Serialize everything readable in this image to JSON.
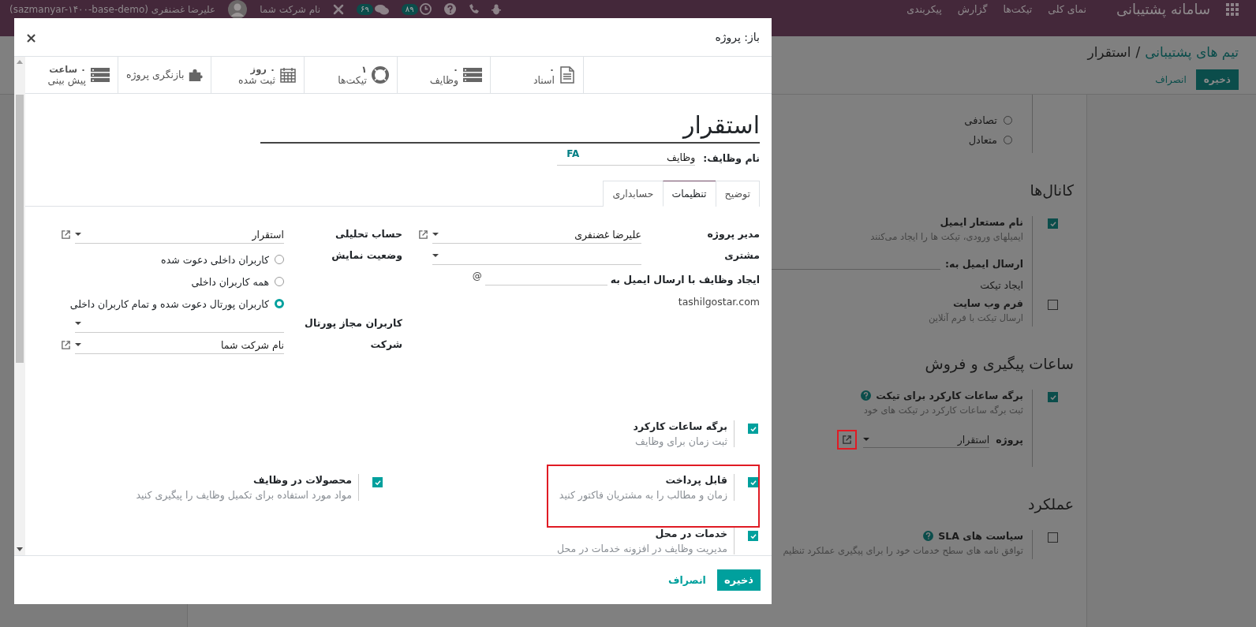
{
  "navbar": {
    "brand": "سامانه پشتیبانی",
    "menu": [
      "نمای کلی",
      "تیکت‌ها",
      "گزارش",
      "پیکربندی"
    ],
    "activity_count": "۸۹",
    "message_count": "۶۹",
    "company": "نام شرکت شما",
    "user": "علیرضا غضنفری (sazmanyar-۱۴۰۰-base-demo)"
  },
  "breadcrumb": {
    "parent": "تیم های پشتیبانی",
    "separator": "/",
    "current": "استقرار"
  },
  "page_actions": {
    "save": "ذخیره",
    "discard": "انصراف"
  },
  "assignment_options": [
    {
      "label": "تصادفی",
      "selected": false
    },
    {
      "label": "متعادل",
      "selected": false
    }
  ],
  "sections": [
    {
      "title": "کانال‌ها",
      "settings": [
        {
          "kind": "alias",
          "label": "نام مستعار ایمیل",
          "checked": true,
          "help": false,
          "description": "ایمیلهای ورودی، تیکت ها را ایجاد می‌کنند",
          "field_label": "ارسال ایمیل به:",
          "note": "ایجاد تیکت"
        },
        {
          "kind": "plain",
          "label": "فرم وب سایت",
          "checked": false,
          "help": false,
          "description": "ارسال تیکت با فرم آنلاین"
        }
      ]
    },
    {
      "title": "ساعات پیگیری و فروش",
      "settings": [
        {
          "kind": "project",
          "label": "برگه ساعات کارکرد برای تیکت",
          "checked": true,
          "help": true,
          "description": "ثبت برگه ساعات کارکرد در تیکت های خود",
          "field_label": "پروژه",
          "field_value": "استقرار",
          "highlighted": true
        }
      ]
    },
    {
      "title": "عملکرد",
      "settings": [
        {
          "kind": "plain",
          "label": "سیاست های SLA",
          "checked": false,
          "help": true,
          "description": "توافق نامه های سطح خدمات خود را برای پیگیری عملکرد تنظیم"
        }
      ]
    }
  ],
  "dialog": {
    "title": "باز: پروژه",
    "close": "×",
    "stat_buttons": [
      {
        "kind": "document",
        "value": "۰",
        "label": "اسناد"
      },
      {
        "kind": "stack",
        "value": "۰",
        "label": "وظایف"
      },
      {
        "kind": "lifebuoy",
        "value": "۱",
        "label": "تیکت‌ها"
      },
      {
        "kind": "calendar",
        "value": "۰ روز",
        "label": "ثبت شده"
      },
      {
        "kind": "puzzle",
        "label": "بازنگری پروژه"
      },
      {
        "kind": "stack",
        "value": "۰ ساعت",
        "label": "پیش بینی"
      }
    ],
    "name": "استقرار",
    "task_name": {
      "label": "نام وظایف:",
      "value": "وظایف",
      "lang": "FA"
    },
    "tabs": [
      {
        "label": "توضیح",
        "selected": false
      },
      {
        "label": "تنظیمات",
        "selected": true
      },
      {
        "label": "حسابداری",
        "selected": false
      }
    ],
    "field_columns": [
      {
        "fields": [
          {
            "kind": "select",
            "label": "مدیر پروژه",
            "value": "علیرضا غضنفری",
            "link": true
          },
          {
            "kind": "select",
            "label": "مشتری",
            "link": false
          },
          {
            "kind": "alias",
            "label": "ایجاد وظایف با ارسال ایمیل به",
            "at": "@",
            "domain": "tashilgostar.com"
          }
        ]
      },
      {
        "fields": [
          {
            "kind": "select",
            "label": "حساب تحلیلی",
            "value": "استقرار",
            "link": true
          },
          {
            "kind": "radio",
            "label": "وضعیت نمایش",
            "options": [
              {
                "label": "کاربران داخلی دعوت شده",
                "selected": false
              },
              {
                "label": "همه کاربران داخلی",
                "selected": false
              },
              {
                "label": "کاربران پورتال دعوت شده و تمام کاربران داخلی",
                "selected": true
              }
            ]
          },
          {
            "kind": "select",
            "label": "کاربران مجاز پورتال",
            "link": false
          },
          {
            "kind": "select",
            "label": "شرکت",
            "value": "نام شرکت شما",
            "link": true
          }
        ]
      }
    ],
    "feature_rows": [
      {
        "items": [
          {
            "label": "برگه ساعات کارکرد",
            "description": "ثبت زمان برای وظایف",
            "checked": true,
            "highlighted": false
          }
        ]
      },
      {
        "items": [
          {
            "label": "قابل پرداخت",
            "description": "زمان و مطالب را به مشتریان فاکتور کنید",
            "checked": true,
            "highlighted": true
          },
          {
            "label": "محصولات در وظایف",
            "description": "مواد مورد استفاده برای تکمیل وظایف را پیگیری کنید",
            "checked": true,
            "highlighted": false
          }
        ]
      },
      {
        "items": [
          {
            "label": "خدمات در محل",
            "description": "مدیریت وظایف در افزونه خدمات در محل",
            "checked": true,
            "highlighted": false
          }
        ]
      }
    ],
    "footer": {
      "save": "ذخیره",
      "discard": "انصراف"
    }
  }
}
